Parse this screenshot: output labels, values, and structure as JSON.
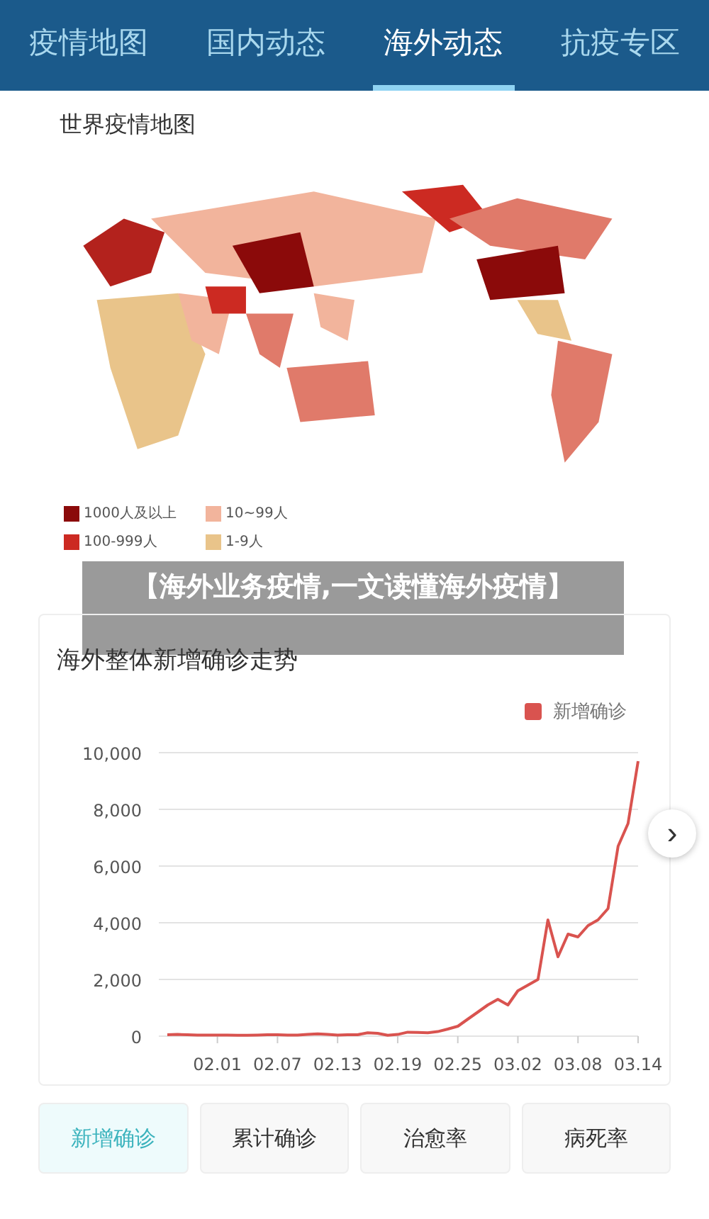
{
  "tabs": [
    {
      "label": "疫情地图",
      "selected": false
    },
    {
      "label": "国内动态",
      "selected": false
    },
    {
      "label": "海外动态",
      "selected": true
    },
    {
      "label": "抗疫专区",
      "selected": false
    }
  ],
  "map_section": {
    "title": "世界疫情地图",
    "legend": [
      {
        "label": "1000人及以上",
        "color": "#8b0a0a"
      },
      {
        "label": "10~99人",
        "color": "#f2b49c"
      },
      {
        "label": "100-999人",
        "color": "#cc2a22"
      },
      {
        "label": "1-9人",
        "color": "#e9c48a"
      }
    ]
  },
  "banner": {
    "text": "【海外业务疫情,一文读懂海外疫情】"
  },
  "trend_card": {
    "title": "海外整体新增确诊走势",
    "next_button": "›",
    "chart_data": {
      "type": "line",
      "categories": [
        null,
        null,
        null,
        null,
        null,
        "02.01",
        null,
        null,
        null,
        null,
        null,
        "02.07",
        null,
        null,
        null,
        null,
        null,
        "02.13",
        null,
        null,
        null,
        null,
        null,
        "02.19",
        null,
        null,
        null,
        null,
        null,
        "02.25",
        null,
        null,
        null,
        null,
        null,
        "03.02",
        null,
        null,
        null,
        null,
        null,
        "03.08",
        null,
        null,
        null,
        null,
        null,
        "03.14"
      ],
      "grid": true,
      "series": [
        {
          "name": "新增确诊",
          "color": "#d9534f",
          "values": [
            50,
            60,
            50,
            40,
            40,
            40,
            40,
            30,
            30,
            40,
            50,
            50,
            40,
            40,
            60,
            80,
            60,
            40,
            50,
            50,
            120,
            100,
            30,
            60,
            140,
            130,
            120,
            160,
            250,
            350,
            600,
            850,
            1100,
            1300,
            1100,
            1600,
            1800,
            2000,
            4100,
            2800,
            3600,
            3500,
            3900,
            4100,
            4500,
            6700,
            7500,
            9700
          ]
        }
      ],
      "ylim": [
        0,
        10000
      ],
      "yticks": [
        {
          "value": 0,
          "label": "0"
        },
        {
          "value": 2000,
          "label": "2,000"
        },
        {
          "value": 4000,
          "label": "4,000"
        },
        {
          "value": 6000,
          "label": "6,000"
        },
        {
          "value": 8000,
          "label": "8,000"
        },
        {
          "value": 10000,
          "label": "10,000"
        }
      ]
    }
  },
  "metric_tabs": [
    {
      "label": "新增确诊",
      "selected": true
    },
    {
      "label": "累计确诊",
      "selected": false
    },
    {
      "label": "治愈率",
      "selected": false
    },
    {
      "label": "病死率",
      "selected": false
    }
  ]
}
